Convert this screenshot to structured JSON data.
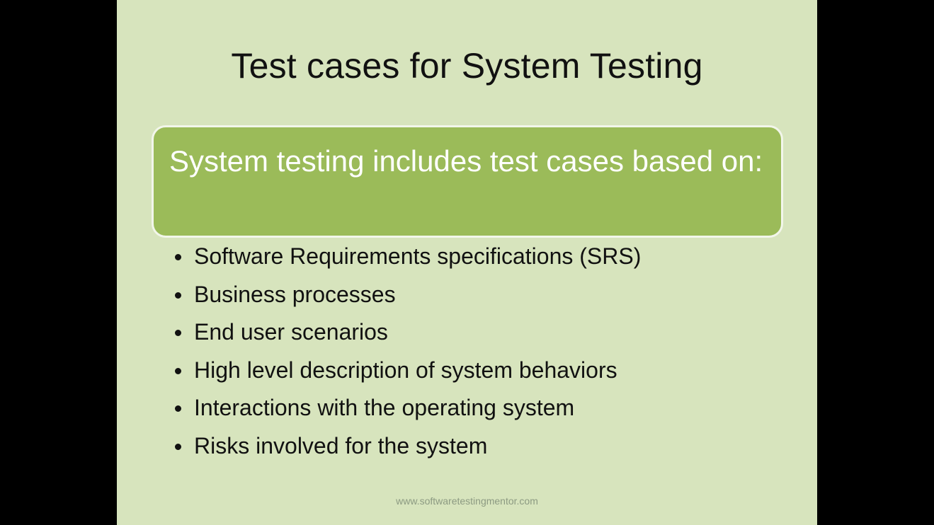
{
  "slide": {
    "title": "Test cases for System Testing",
    "callout": "System testing includes test cases based on:",
    "bullets": [
      "Software Requirements specifications (SRS)",
      "Business processes",
      "End user scenarios",
      "High level description of system behaviors",
      "Interactions with the operating system",
      "Risks involved for the system"
    ],
    "footer": "www.softwaretestingmentor.com"
  },
  "colors": {
    "background": "#000000",
    "slide_background": "#d7e4bd",
    "callout_fill": "#9bbb59",
    "callout_border": "#f2f6ea",
    "text": "#111111",
    "callout_text": "#ffffff",
    "footer_text": "#8c9a82"
  }
}
